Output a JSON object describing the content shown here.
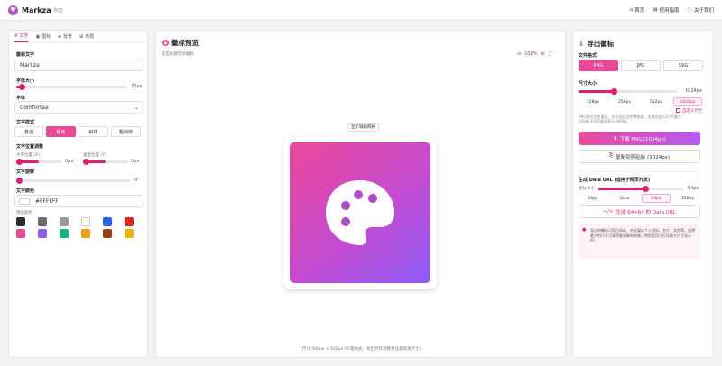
{
  "app": {
    "brand": "Markza",
    "brand_sub": "标志",
    "nav": [
      "首页",
      "使用指南",
      "关于我们"
    ]
  },
  "left": {
    "tabs": [
      "文字",
      "图标",
      "背景",
      "布局"
    ],
    "text_label": "徽标文字",
    "text_value": "Markza",
    "font_size_label": "字体大小",
    "font_size_value": "32px",
    "font_size_pct": 0.05,
    "font_label": "字体",
    "font_value": "Comfortaa",
    "style_label": "文字样式",
    "styles": [
      "普通",
      "粗体",
      "斜体",
      "粗斜体"
    ],
    "style_active": 1,
    "position_label": "文字位置调整",
    "h_offset_label": "水平位置 (X)",
    "h_offset_value": "0px",
    "v_offset_label": "垂直位置 (Y)",
    "v_offset_value": "0px",
    "rotate_label": "文字旋转",
    "rotate_value": "0°",
    "color_label": "文字颜色",
    "color_value": "#FFFFFF",
    "preset_label": "预设颜色",
    "presets": [
      "#2b2b2b",
      "#6b6b6b",
      "#9a9a9a",
      "#ffffff",
      "#2563eb",
      "#dc2626",
      "#ec4899",
      "#8b5cf6",
      "#10b981",
      "#f59e0b",
      "#92400e",
      "#eab308"
    ]
  },
  "center": {
    "title": "徽标预览",
    "subtitle": "您是标题您的徽标",
    "zoom": "100%",
    "toggle_label": "显示辅助网格",
    "footer": "尺寸:500px × 500px (矢量格式，导出时可调整为任意高清尺寸)"
  },
  "right": {
    "title": "导出徽标",
    "format_label": "文件格式",
    "formats": [
      "PNG",
      "JPG",
      "SVG"
    ],
    "format_active": 0,
    "size_label": "尺寸大小",
    "size_value": "1024px",
    "size_pct": 0.35,
    "sizes": [
      "128px",
      "256px",
      "512px",
      "1024px"
    ],
    "size_active": 3,
    "custom_label": "自定义尺寸",
    "note": "PNG格式为矢量图，在导出时会完整保留，支持自定义尺寸(最大2000×1000或3000×3000)。",
    "download": "下载 PNG (1024px)",
    "copy": "复制到剪贴板 (1024px)",
    "dataurl_label": "生成 Data URL (适用于网页开发)",
    "dataurl_size_label": "图标大小",
    "dataurl_size_value": "64px",
    "dataurl_pct": 0.55,
    "dataurl_sizes": [
      "16px",
      "32px",
      "64px",
      "128px"
    ],
    "dataurl_active": 2,
    "dataurl_btn": "生成 64×64 的 Data URL",
    "tip": "导出的徽标可用于网站、社交媒体个人资料、名片、文档等。选择更大的尺寸可获得更清晰的效果，特别是用于打印或大尺寸显示时。"
  },
  "colors": {
    "accent": "#e11d74",
    "pink": "#ec4899",
    "purple": "#8b5cf6"
  }
}
